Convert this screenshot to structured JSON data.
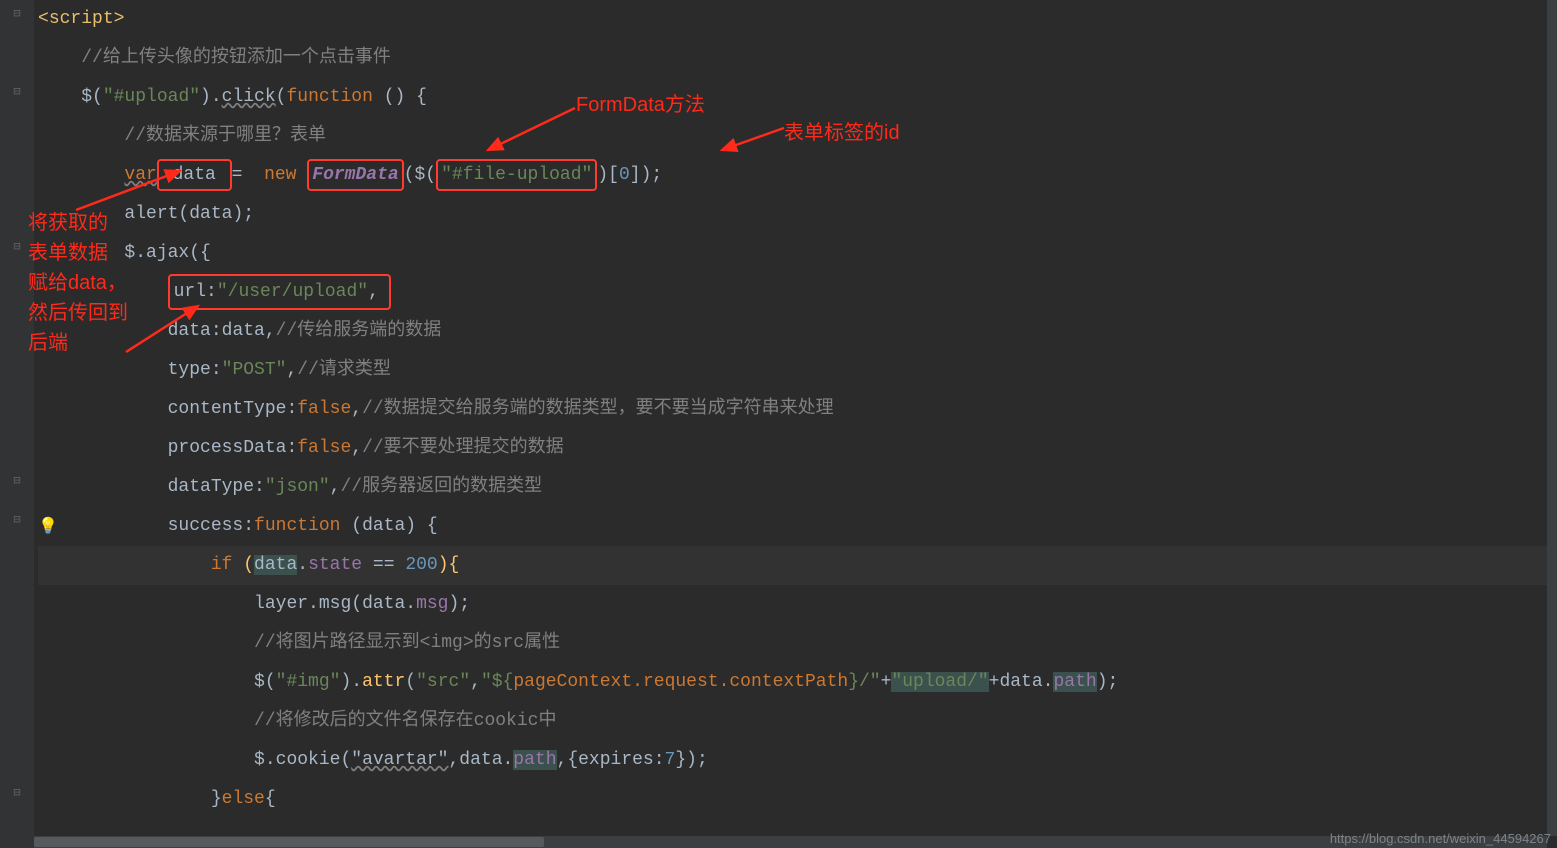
{
  "code": {
    "l1": {
      "tag_open": "<",
      "tag_name": "script",
      "tag_close": ">"
    },
    "l2": {
      "comment": "//给上传头像的按钮添加一个点击事件"
    },
    "l3": {
      "dollar": "$(",
      "sel": "\"#upload\"",
      "dot": ").",
      "click": "click",
      "fn_open": "(",
      "kw_fn": "function ",
      "paren": "() {"
    },
    "l4": {
      "comment": "//数据来源于哪里？表单"
    },
    "l5": {
      "kw_var": "var",
      "var_name": " data ",
      "eq": "= ",
      "kw_new": "new ",
      "cls": "FormData",
      "open": "($(",
      "sel": "\"#file-upload\"",
      "close": ")[",
      "num": "0",
      "end": "]);"
    },
    "l6": {
      "call": "alert(data);"
    },
    "l7": {
      "call": "$.ajax({"
    },
    "l8": {
      "key": "url:",
      "val": "\"/user/upload\"",
      "comma": ","
    },
    "l9": {
      "key": "data:",
      "val": "data",
      "comma": ",",
      "comment": "//传给服务端的数据"
    },
    "l10": {
      "key": "type:",
      "val": "\"POST\"",
      "comma": ",",
      "comment": "//请求类型"
    },
    "l11": {
      "key": "contentType:",
      "val": "false",
      "comma": ",",
      "comment": "//数据提交给服务端的数据类型，要不要当成字符串来处理"
    },
    "l12": {
      "key": "processData:",
      "val": "false",
      "comma": ",",
      "comment": "//要不要处理提交的数据"
    },
    "l13": {
      "key": "dataType:",
      "val": "\"json\"",
      "comma": ",",
      "comment": "//服务器返回的数据类型"
    },
    "l14": {
      "key": "success:",
      "kw_fn": "function ",
      "paren": "(",
      "param": "data",
      "paren2": ") {"
    },
    "l15": {
      "kw_if": "if ",
      "open": "(",
      "obj": "data",
      "dot": ".",
      "prop": "state",
      "eq": " == ",
      "num": "200",
      "close": "){"
    },
    "l16": {
      "obj": "layer.msg(data.",
      "prop": "msg",
      "close": ");"
    },
    "l17": {
      "comment": "//将图片路径显示到<img>的src属性"
    },
    "l18": {
      "dollar": "$(",
      "sel": "\"#img\"",
      "dot": ").",
      "fn": "attr",
      "open": "(",
      "arg1": "\"src\"",
      "comma": ",",
      "arg2": "\"${",
      "expr": "pageContext.request.contextPath",
      "arg2b": "}/\"",
      "plus": "+",
      "arg3": "\"upload/\"",
      "plus2": "+",
      "obj": "data.",
      "prop": "path",
      "close": ");"
    },
    "l19": {
      "comment": "//将修改后的文件名保存在cookic中"
    },
    "l20": {
      "call": "$.cookie(",
      "arg1": "\"avartar\"",
      "comma": ",data.",
      "prop": "path",
      "comma2": ",{expires:",
      "num": "7",
      "close": "});"
    },
    "l21": {
      "else": "}",
      "kw": "else",
      "brace": "{"
    }
  },
  "annotations": {
    "formdata": "FormData方法",
    "formid": "表单标签的id",
    "left": "将获取的\n表单数据\n赋给data，\n然后传回到\n后端"
  },
  "watermark": "https://blog.csdn.net/weixin_44594267"
}
